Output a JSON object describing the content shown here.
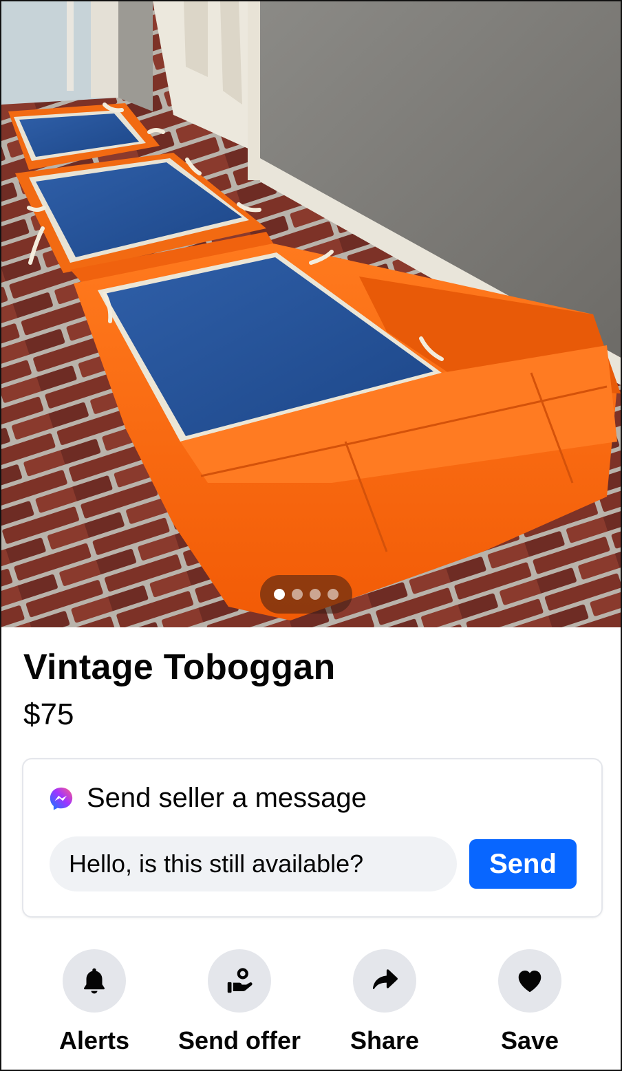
{
  "photo": {
    "description_icon": "listing-photo",
    "carousel": {
      "count": 4,
      "active_index": 0
    }
  },
  "listing": {
    "title": "Vintage Toboggan",
    "price": "$75"
  },
  "message": {
    "icon": "messenger-icon",
    "heading": "Send seller a message",
    "input_value": "Hello, is this still available?",
    "send_label": "Send",
    "send_color": "#0866ff"
  },
  "actions": [
    {
      "icon": "bell-icon",
      "label": "Alerts"
    },
    {
      "icon": "send-offer-icon",
      "label": "Send offer"
    },
    {
      "icon": "share-arrow-icon",
      "label": "Share"
    },
    {
      "icon": "heart-icon",
      "label": "Save"
    }
  ]
}
